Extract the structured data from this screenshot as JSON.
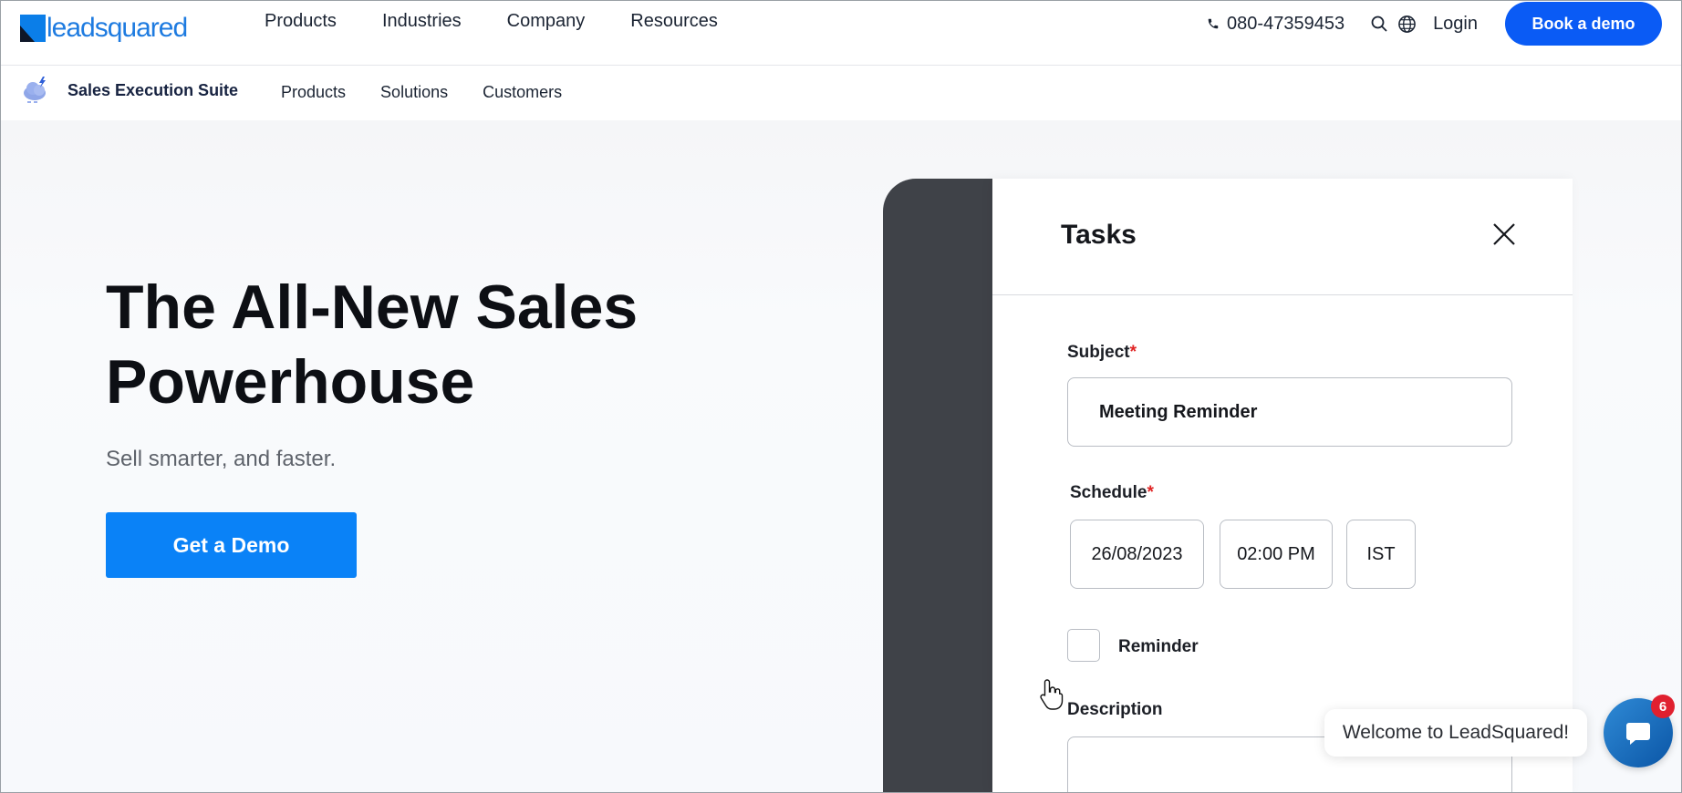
{
  "topnav": {
    "logo_text": "leadsquared",
    "menu": [
      "Products",
      "Industries",
      "Company",
      "Resources"
    ],
    "phone": "080-47359453",
    "login": "Login",
    "book_demo": "Book a demo"
  },
  "subnav": {
    "suite_name": "Sales Execution Suite",
    "menu": [
      "Products",
      "Solutions",
      "Customers"
    ]
  },
  "hero": {
    "title_line1": "The All-New Sales",
    "title_line2": "Powerhouse",
    "subtitle": "Sell smarter, and faster.",
    "cta": "Get a Demo"
  },
  "tasks_panel": {
    "title": "Tasks",
    "subject_label": "Subject",
    "subject_value": "Meeting Reminder",
    "schedule_label": "Schedule",
    "date": "26/08/2023",
    "time": "02:00 PM",
    "timezone": "IST",
    "reminder_label": "Reminder",
    "description_label": "Description",
    "required_marker": "*"
  },
  "chat": {
    "welcome": "Welcome to LeadSquared!",
    "badge_count": "6"
  },
  "colors": {
    "primary": "#0a5bf5",
    "cta": "#0a82f7",
    "required": "#e02424",
    "device_dark": "#3f4248"
  }
}
